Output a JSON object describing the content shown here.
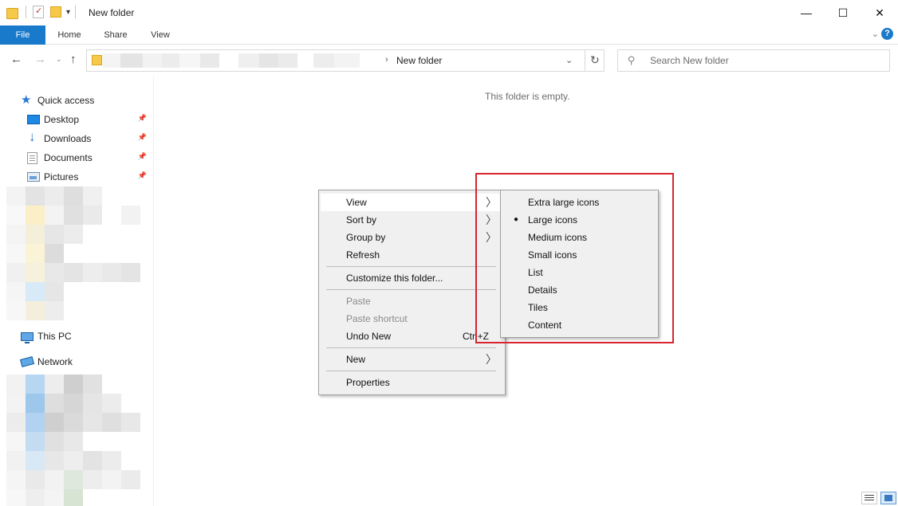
{
  "window": {
    "title": "New folder",
    "minimize_glyph": "—",
    "maximize_glyph": "☐",
    "close_glyph": "✕"
  },
  "ribbon": {
    "tabs": [
      {
        "label": "File"
      },
      {
        "label": "Home"
      },
      {
        "label": "Share"
      },
      {
        "label": "View"
      }
    ],
    "help_glyph": "?"
  },
  "navbar": {
    "back_glyph": "←",
    "forward_glyph": "→",
    "recent_glyph": "⌄",
    "up_glyph": "↑",
    "address_current": "New folder",
    "address_separator": "›",
    "address_dropdown_glyph": "⌄",
    "refresh_glyph": "↻",
    "search_placeholder": "Search New folder",
    "search_glyph": "⚲"
  },
  "sidebar": {
    "items": [
      {
        "label": "Quick access",
        "icon": "star-icon"
      },
      {
        "label": "Desktop",
        "icon": "desktop-icon",
        "pinned": true
      },
      {
        "label": "Downloads",
        "icon": "downloads-icon",
        "pinned": true
      },
      {
        "label": "Documents",
        "icon": "documents-icon",
        "pinned": true
      },
      {
        "label": "Pictures",
        "icon": "pictures-icon",
        "pinned": true
      },
      {
        "label": "This PC",
        "icon": "pc-icon"
      },
      {
        "label": "Network",
        "icon": "network-icon"
      }
    ],
    "pin_glyph": "📌"
  },
  "content": {
    "empty_message": "This folder is empty."
  },
  "context_menu": {
    "items": [
      {
        "label": "View",
        "submenu": true,
        "highlighted": true
      },
      {
        "label": "Sort by",
        "submenu": true
      },
      {
        "label": "Group by",
        "submenu": true
      },
      {
        "label": "Refresh"
      },
      {
        "label": "Customize this folder..."
      },
      {
        "label": "Paste",
        "disabled": true
      },
      {
        "label": "Paste shortcut",
        "disabled": true
      },
      {
        "label": "Undo New",
        "shortcut": "Ctrl+Z"
      },
      {
        "label": "New",
        "submenu": true
      },
      {
        "label": "Properties"
      }
    ],
    "arrow_glyph": "〉"
  },
  "view_submenu": {
    "items": [
      {
        "label": "Extra large icons"
      },
      {
        "label": "Large icons",
        "selected": true
      },
      {
        "label": "Medium icons"
      },
      {
        "label": "Small icons"
      },
      {
        "label": "List"
      },
      {
        "label": "Details"
      },
      {
        "label": "Tiles"
      },
      {
        "label": "Content"
      }
    ],
    "bullet_glyph": "●"
  },
  "colors": {
    "accent": "#1979ca",
    "highlight_box": "#d8242c",
    "menu_bg": "#f0f0f0"
  }
}
